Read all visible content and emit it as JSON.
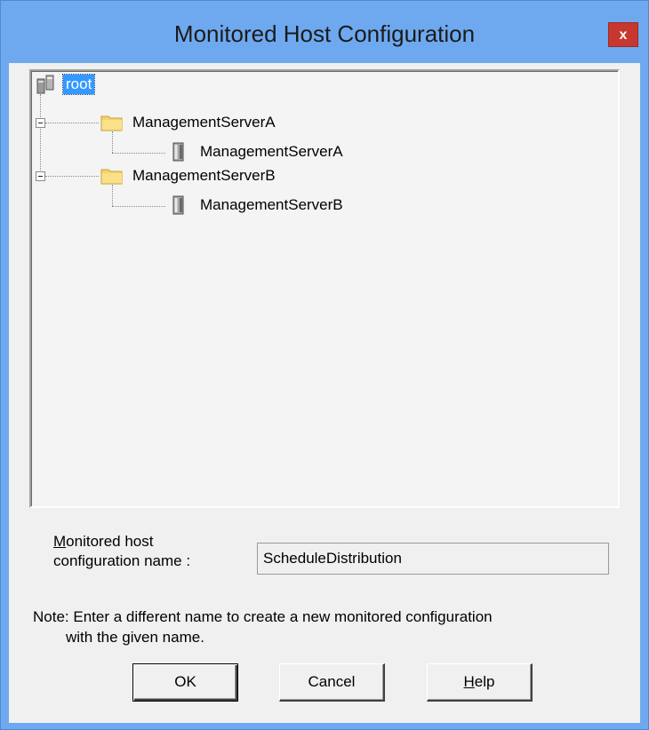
{
  "window": {
    "title": "Monitored Host Configuration",
    "close_symbol": "x"
  },
  "tree": {
    "root": {
      "label": "root",
      "icon": "servers-icon",
      "selected": true
    },
    "groups": [
      {
        "label": "ManagementServerA",
        "icon": "folder-icon",
        "expanded": true,
        "children": [
          {
            "label": "ManagementServerA",
            "icon": "server-icon"
          }
        ]
      },
      {
        "label": "ManagementServerB",
        "icon": "folder-icon",
        "expanded": true,
        "children": [
          {
            "label": "ManagementServerB",
            "icon": "server-icon"
          }
        ]
      }
    ]
  },
  "form": {
    "name_label_mnemonic": "M",
    "name_label_line1_rest": "onitored host",
    "name_label_line2": "configuration name :",
    "name_value": "ScheduleDistribution"
  },
  "note": {
    "line1": "Note: Enter a different name to create a new monitored configuration",
    "line2": "with the given name."
  },
  "buttons": {
    "ok": "OK",
    "cancel": "Cancel",
    "help_mnemonic": "H",
    "help_rest": "elp"
  },
  "colors": {
    "title_bar": "#6ea9f0",
    "close_button": "#c7372f",
    "selection": "#3399ff",
    "dialog_bg": "#f0f0f0"
  }
}
